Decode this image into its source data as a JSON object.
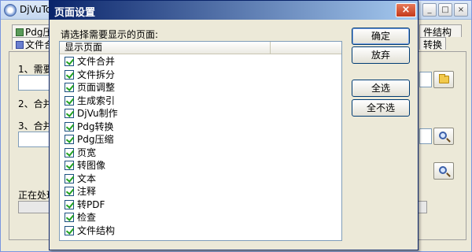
{
  "main": {
    "title": "DjVuTo",
    "tabs": [
      {
        "label": "Pdg压缩"
      },
      {
        "label": "文件合"
      },
      {
        "label": "件结构"
      },
      {
        "label": "转换"
      }
    ],
    "labels": {
      "need": "1、需要",
      "merge": "2、合并",
      "merge3": "3、合并",
      "processing": "正在处理"
    },
    "icons": [
      "app-icon",
      "folder-icon",
      "magnifier-icon"
    ]
  },
  "dialog": {
    "title": "页面设置",
    "close_label": "×",
    "prompt": "请选择需要显示的页面:",
    "list_header": "显示页面",
    "pages": [
      {
        "label": "文件合并",
        "checked": true
      },
      {
        "label": "文件拆分",
        "checked": true
      },
      {
        "label": "页面调整",
        "checked": true
      },
      {
        "label": "生成索引",
        "checked": true
      },
      {
        "label": "DjVu制作",
        "checked": true
      },
      {
        "label": "Pdg转换",
        "checked": true
      },
      {
        "label": "Pdg压缩",
        "checked": true
      },
      {
        "label": "页宽",
        "checked": true
      },
      {
        "label": "转图像",
        "checked": true
      },
      {
        "label": "文本",
        "checked": true
      },
      {
        "label": "注释",
        "checked": true
      },
      {
        "label": "转PDF",
        "checked": true
      },
      {
        "label": "检查",
        "checked": true
      },
      {
        "label": "文件结构",
        "checked": true
      }
    ],
    "buttons": {
      "ok": "确定",
      "cancel": "放弃",
      "select_all": "全选",
      "select_none": "全不选"
    }
  }
}
